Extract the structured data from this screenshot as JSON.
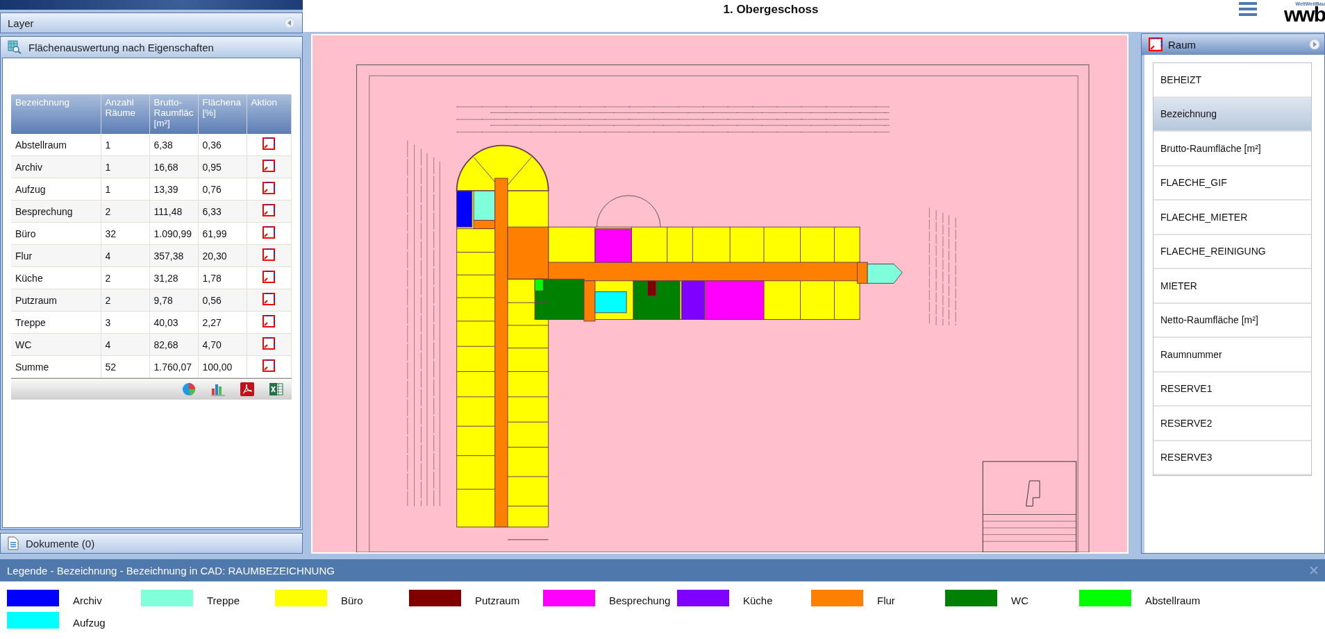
{
  "top_bar": {
    "title": "1. Obergeschoss",
    "logo": {
      "tagline": "WeltWeitBau",
      "mark": "wwb"
    }
  },
  "layer_panel": {
    "title": "Layer"
  },
  "analysis_panel": {
    "title": "Flächenauswertung nach Eigenschaften",
    "table": {
      "columns": [
        "Bezeichnung",
        "Anzahl Räume",
        "Brutto-Raumfläc [m²]",
        "Flächena [%]",
        "Aktion"
      ],
      "rows": [
        [
          "Abstellraum",
          "1",
          "6,38",
          "0,36"
        ],
        [
          "Archiv",
          "1",
          "16,68",
          "0,95"
        ],
        [
          "Aufzug",
          "1",
          "13,39",
          "0,76"
        ],
        [
          "Besprechung",
          "2",
          "111,48",
          "6,33"
        ],
        [
          "Büro",
          "32",
          "1.090,99",
          "61,99"
        ],
        [
          "Flur",
          "4",
          "357,38",
          "20,30"
        ],
        [
          "Küche",
          "2",
          "31,28",
          "1,78"
        ],
        [
          "Putzraum",
          "2",
          "9,78",
          "0,56"
        ],
        [
          "Treppe",
          "3",
          "40,03",
          "2,27"
        ],
        [
          "WC",
          "4",
          "82,68",
          "4,70"
        ],
        [
          "Summe",
          "52",
          "1.760,07",
          "100,00"
        ]
      ]
    }
  },
  "documents_panel": {
    "title": "Dokumente (0)"
  },
  "property_panel": {
    "title": "Raum",
    "items": [
      {
        "label": "BEHEIZT",
        "selected": false
      },
      {
        "label": "Bezeichnung",
        "selected": true
      },
      {
        "label": "Brutto-Raumfläche [m²]",
        "selected": false
      },
      {
        "label": "FLAECHE_GIF",
        "selected": false
      },
      {
        "label": "FLAECHE_MIETER",
        "selected": false
      },
      {
        "label": "FLAECHE_REINIGUNG",
        "selected": false
      },
      {
        "label": "MIETER",
        "selected": false
      },
      {
        "label": "Netto-Raumfläche [m²]",
        "selected": false
      },
      {
        "label": "Raumnummer",
        "selected": false
      },
      {
        "label": "RESERVE1",
        "selected": false
      },
      {
        "label": "RESERVE2",
        "selected": false
      },
      {
        "label": "RESERVE3",
        "selected": false
      }
    ]
  },
  "legend": {
    "title": "Legende - Bezeichnung - Bezeichnung in CAD: RAUMBEZEICHNUNG",
    "items": [
      {
        "label": "Archiv",
        "color": "#0000ff"
      },
      {
        "label": "Treppe",
        "color": "#80ffdb"
      },
      {
        "label": "Büro",
        "color": "#ffff00"
      },
      {
        "label": "Putzraum",
        "color": "#800000"
      },
      {
        "label": "Besprechung",
        "color": "#ff00ff"
      },
      {
        "label": "Küche",
        "color": "#8000ff"
      },
      {
        "label": "Flur",
        "color": "#ff8000"
      },
      {
        "label": "WC",
        "color": "#008000"
      },
      {
        "label": "Abstellraum",
        "color": "#00ff00"
      },
      {
        "label": "Aufzug",
        "color": "#00ffff"
      }
    ]
  }
}
